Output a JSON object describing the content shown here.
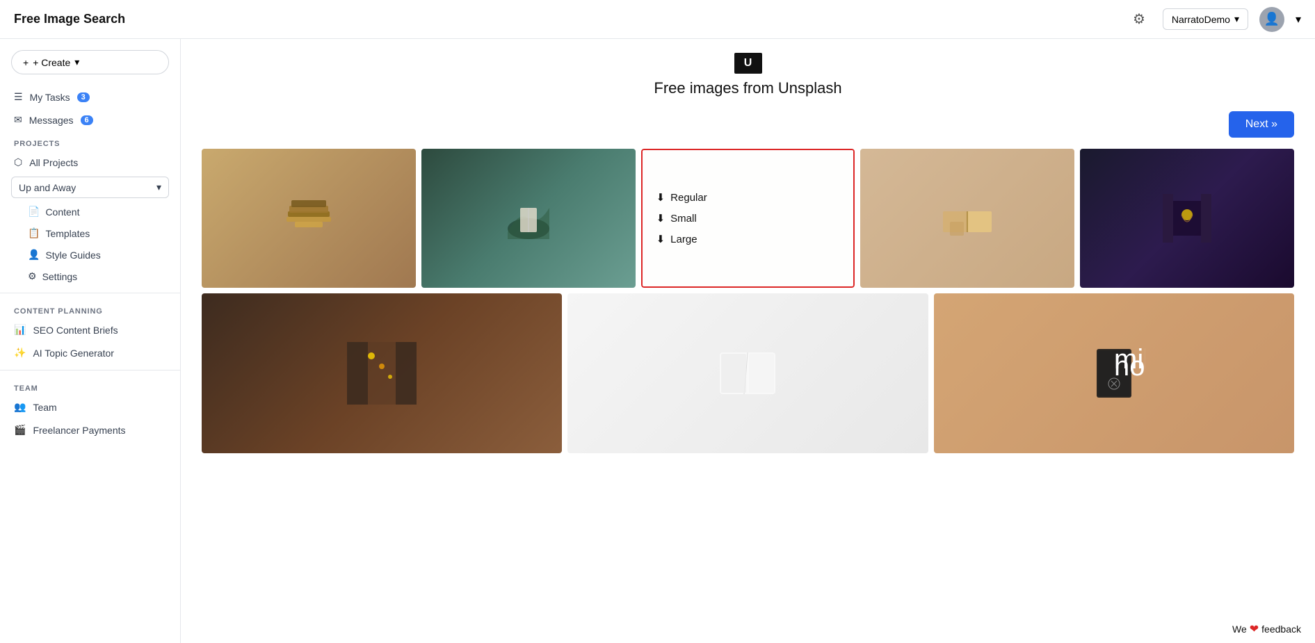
{
  "topNav": {
    "title": "Free Image Search",
    "workspace": "NarratoDemo",
    "gearIcon": "⚙",
    "userIcon": "👤",
    "chevronIcon": "▾"
  },
  "sidebar": {
    "createButton": "+ Create",
    "createChevron": "▾",
    "myTasks": {
      "label": "My Tasks",
      "badge": "3",
      "icon": "☰"
    },
    "messages": {
      "label": "Messages",
      "badge": "6",
      "icon": "✉"
    },
    "sections": {
      "projects": {
        "label": "PROJECTS",
        "allProjects": "All Projects",
        "allProjectsIcon": "⬡",
        "currentProject": "Up and Away",
        "chevron": "▾",
        "subItems": [
          {
            "label": "Content",
            "icon": "📄"
          },
          {
            "label": "Templates",
            "icon": "📋"
          },
          {
            "label": "Style Guides",
            "icon": "👤"
          },
          {
            "label": "Settings",
            "icon": "⚙"
          }
        ]
      },
      "contentPlanning": {
        "label": "CONTENT PLANNING",
        "items": [
          {
            "label": "SEO Content Briefs",
            "icon": "📊"
          },
          {
            "label": "AI Topic Generator",
            "icon": "✨"
          }
        ]
      },
      "team": {
        "label": "TEAM",
        "items": [
          {
            "label": "Team",
            "icon": "👥"
          },
          {
            "label": "Freelancer Payments",
            "icon": "🎬"
          }
        ]
      }
    }
  },
  "main": {
    "unsplashIcon": "U",
    "pageTitle": "Free images from Unsplash",
    "nextButton": "Next »",
    "downloadOptions": {
      "regular": "Regular",
      "small": "Small",
      "large": "Large",
      "downloadIcon": "⬇"
    },
    "images": {
      "row1": [
        {
          "alt": "Stack of open books on beige background",
          "class": "img-books-stack"
        },
        {
          "alt": "Misty mountain landscape with open book",
          "class": "img-misty-mountain"
        },
        {
          "alt": "Book download options",
          "class": "img-white-book",
          "hasPopup": true
        },
        {
          "alt": "Open books on table with sunlight",
          "class": "img-open-books"
        },
        {
          "alt": "Dark library corridor with glowing light",
          "class": "img-dark-library"
        }
      ],
      "row2": [
        {
          "alt": "Long library hall with warm lights",
          "class": "img-library-hall"
        },
        {
          "alt": "White book pages close up",
          "class": "img-white-pages"
        },
        {
          "alt": "Milk and Honey book on wooden table",
          "class": "img-milk-honey"
        }
      ]
    }
  },
  "feedback": {
    "text": "We",
    "heartIcon": "❤",
    "label": "feedback"
  }
}
